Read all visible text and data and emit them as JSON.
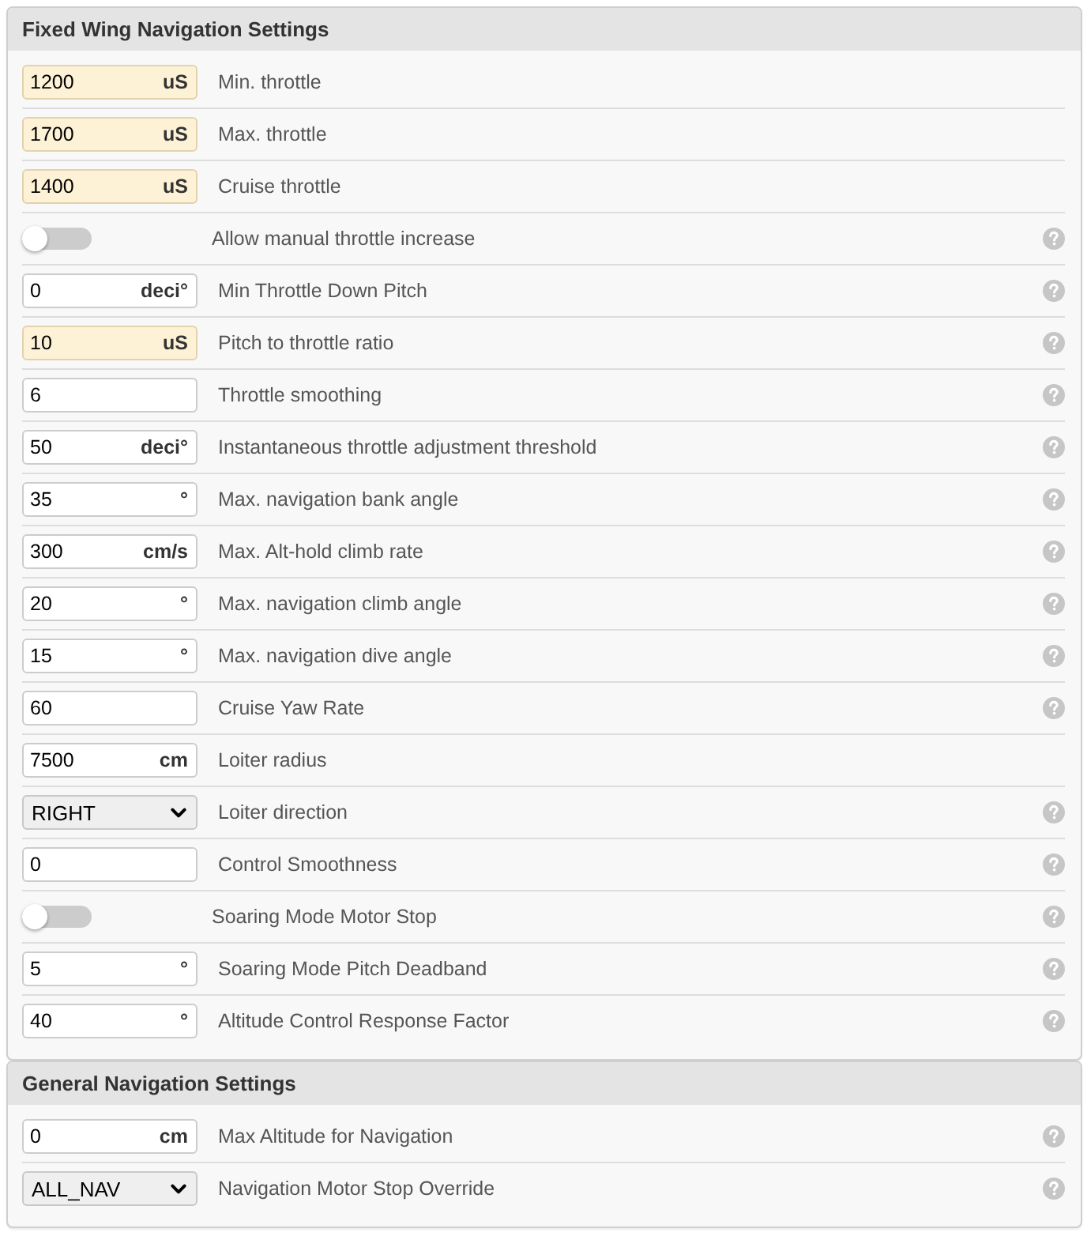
{
  "panels": [
    {
      "title": "Fixed Wing Navigation Settings",
      "rows": [
        {
          "kind": "number",
          "value": "1200",
          "unit": "uS",
          "label": "Min. throttle",
          "highlighted": true,
          "help": false
        },
        {
          "kind": "number",
          "value": "1700",
          "unit": "uS",
          "label": "Max. throttle",
          "highlighted": true,
          "help": false
        },
        {
          "kind": "number",
          "value": "1400",
          "unit": "uS",
          "label": "Cruise throttle",
          "highlighted": true,
          "help": false
        },
        {
          "kind": "toggle",
          "on": false,
          "label": "Allow manual throttle increase",
          "help": true
        },
        {
          "kind": "number",
          "value": "0",
          "unit": "deci°",
          "label": "Min Throttle Down Pitch",
          "highlighted": false,
          "help": true
        },
        {
          "kind": "number",
          "value": "10",
          "unit": "uS",
          "label": "Pitch to throttle ratio",
          "highlighted": true,
          "help": true
        },
        {
          "kind": "number",
          "value": "6",
          "label": "Throttle smoothing",
          "highlighted": false,
          "help": true
        },
        {
          "kind": "number",
          "value": "50",
          "unit": "deci°",
          "label": "Instantaneous throttle adjustment threshold",
          "highlighted": false,
          "help": true
        },
        {
          "kind": "number",
          "value": "35",
          "unit": "°",
          "label": "Max. navigation bank angle",
          "highlighted": false,
          "help": true
        },
        {
          "kind": "number",
          "value": "300",
          "unit": "cm/s",
          "label": "Max. Alt-hold climb rate",
          "highlighted": false,
          "help": true
        },
        {
          "kind": "number",
          "value": "20",
          "unit": "°",
          "label": "Max. navigation climb angle",
          "highlighted": false,
          "help": true
        },
        {
          "kind": "number",
          "value": "15",
          "unit": "°",
          "label": "Max. navigation dive angle",
          "highlighted": false,
          "help": true
        },
        {
          "kind": "number",
          "value": "60",
          "label": "Cruise Yaw Rate",
          "highlighted": false,
          "help": true
        },
        {
          "kind": "number",
          "value": "7500",
          "unit": "cm",
          "label": "Loiter radius",
          "highlighted": false,
          "help": false
        },
        {
          "kind": "select",
          "value": "RIGHT",
          "label": "Loiter direction",
          "help": true
        },
        {
          "kind": "number",
          "value": "0",
          "label": "Control Smoothness",
          "highlighted": false,
          "help": true
        },
        {
          "kind": "toggle",
          "on": false,
          "label": "Soaring Mode Motor Stop",
          "help": true
        },
        {
          "kind": "number",
          "value": "5",
          "unit": "°",
          "label": "Soaring Mode Pitch Deadband",
          "highlighted": false,
          "help": true
        },
        {
          "kind": "number",
          "value": "40",
          "unit": "°",
          "label": "Altitude Control Response Factor",
          "highlighted": false,
          "help": true
        }
      ]
    },
    {
      "title": "General Navigation Settings",
      "rows": [
        {
          "kind": "number",
          "value": "0",
          "unit": "cm",
          "label": "Max Altitude for Navigation",
          "highlighted": false,
          "help": true
        },
        {
          "kind": "select",
          "value": "ALL_NAV",
          "label": "Navigation Motor Stop Override",
          "help": true
        }
      ]
    }
  ]
}
